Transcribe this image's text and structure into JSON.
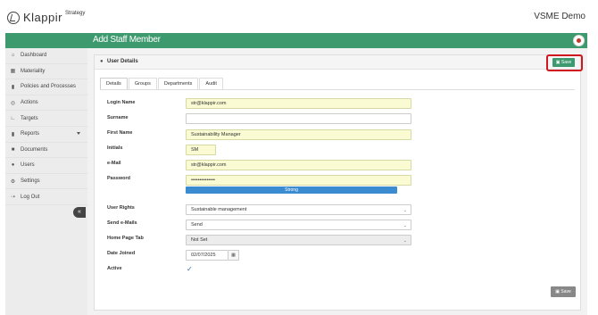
{
  "header": {
    "logo_name": "Klappir",
    "logo_suffix": "Strategy",
    "org_name": "VSME Demo"
  },
  "page": {
    "title": "Add Staff Member"
  },
  "sidebar": {
    "items": [
      {
        "label": "Dashboard",
        "icon": "home-icon"
      },
      {
        "label": "Materiality",
        "icon": "grid-icon"
      },
      {
        "label": "Policies and Processes",
        "icon": "file-icon"
      },
      {
        "label": "Actions",
        "icon": "target-icon"
      },
      {
        "label": "Targets",
        "icon": "chart-icon"
      },
      {
        "label": "Reports",
        "icon": "report-icon",
        "has_submenu": true
      },
      {
        "label": "Documents",
        "icon": "folder-icon"
      },
      {
        "label": "Users",
        "icon": "users-icon"
      },
      {
        "label": "Settings",
        "icon": "gears-icon"
      },
      {
        "label": "Log Out",
        "icon": "logout-icon"
      }
    ]
  },
  "panel": {
    "title": "User Details",
    "save_label": "Save",
    "tabs": [
      "Details",
      "Groups",
      "Departments",
      "Audit"
    ],
    "active_tab": "Details"
  },
  "form": {
    "login_name_label": "Login Name",
    "login_name_value": "str@klappir.com",
    "surname_label": "Surname",
    "surname_value": "",
    "first_name_label": "First Name",
    "first_name_value": "Sustainability Manager",
    "initials_label": "Initials",
    "initials_value": "SM",
    "email_label": "e-Mail",
    "email_value": "str@klappir.com",
    "password_label": "Password",
    "password_value": "••••••••••••••",
    "password_strength": "Strong",
    "user_rights_label": "User Rights",
    "user_rights_value": "Sustainable management",
    "send_emails_label": "Send e-Mails",
    "send_emails_value": "Send",
    "home_tab_label": "Home Page Tab",
    "home_tab_value": "Not Set",
    "date_joined_label": "Date Joined",
    "date_joined_value": "02/07/2025",
    "active_label": "Active",
    "active_checked": true
  },
  "colors": {
    "brand_green": "#3d9a6e",
    "highlight_red": "#d0161e",
    "strength_blue": "#3b8bd0",
    "autofill_yellow": "#fafbd3"
  }
}
